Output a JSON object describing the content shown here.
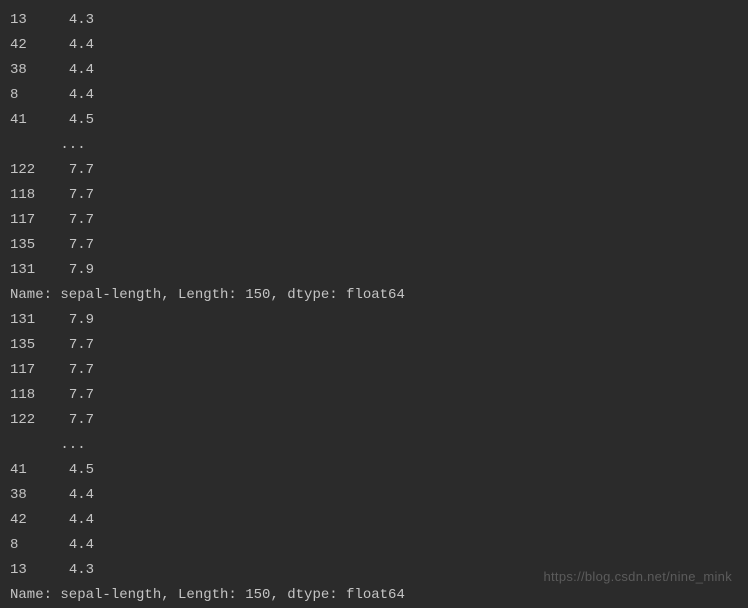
{
  "output": {
    "block1": {
      "rows": [
        {
          "index": "13",
          "value": "4.3"
        },
        {
          "index": "42",
          "value": "4.4"
        },
        {
          "index": "38",
          "value": "4.4"
        },
        {
          "index": "8",
          "value": "4.4"
        },
        {
          "index": "41",
          "value": "4.5"
        }
      ],
      "ellipsis": "      ... ",
      "tail_rows": [
        {
          "index": "122",
          "value": "7.7"
        },
        {
          "index": "118",
          "value": "7.7"
        },
        {
          "index": "117",
          "value": "7.7"
        },
        {
          "index": "135",
          "value": "7.7"
        },
        {
          "index": "131",
          "value": "7.9"
        }
      ],
      "summary": "Name: sepal-length, Length: 150, dtype: float64"
    },
    "block2": {
      "rows": [
        {
          "index": "131",
          "value": "7.9"
        },
        {
          "index": "135",
          "value": "7.7"
        },
        {
          "index": "117",
          "value": "7.7"
        },
        {
          "index": "118",
          "value": "7.7"
        },
        {
          "index": "122",
          "value": "7.7"
        }
      ],
      "ellipsis": "      ... ",
      "tail_rows": [
        {
          "index": "41",
          "value": "4.5"
        },
        {
          "index": "38",
          "value": "4.4"
        },
        {
          "index": "42",
          "value": "4.4"
        },
        {
          "index": "8",
          "value": "4.4"
        },
        {
          "index": "13",
          "value": "4.3"
        }
      ],
      "summary": "Name: sepal-length, Length: 150, dtype: float64"
    }
  },
  "watermark": "https://blog.csdn.net/nine_mink"
}
